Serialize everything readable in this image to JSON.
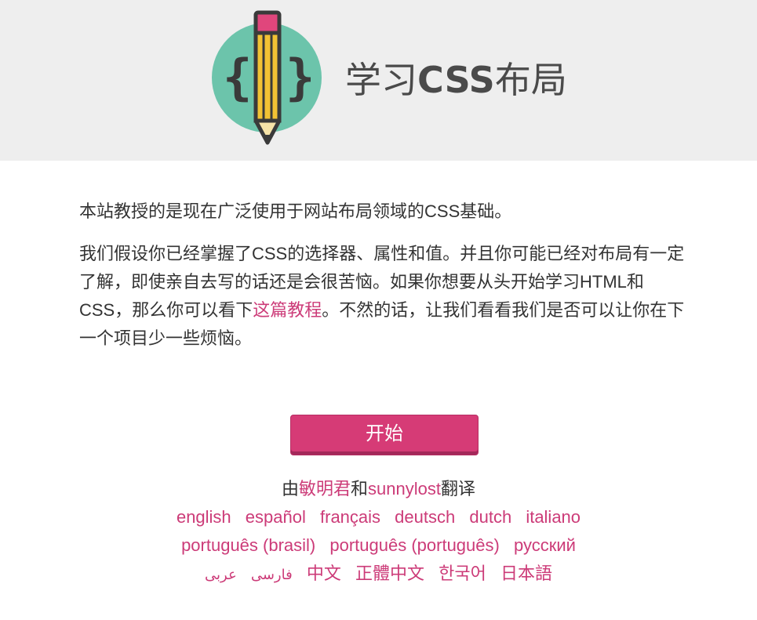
{
  "header": {
    "title_prefix": "学习",
    "title_css": "CSS",
    "title_suffix": "布局"
  },
  "intro": "本站教授的是现在广泛使用于网站布局领域的CSS基础。",
  "description": {
    "before_link": "我们假设你已经掌握了CSS的选择器、属性和值。并且你可能已经对布局有一定了解，即使亲自去写的话还是会很苦恼。如果你想要从头开始学习HTML和CSS，那么你可以看下",
    "link_text": "这篇教程",
    "after_link": "。不然的话，让我们看看我们是否可以让你在下一个项目少一些烦恼。"
  },
  "start_button": "开始",
  "credits": {
    "prefix": "由",
    "translator1": "敏明君",
    "joiner": "和",
    "translator2": "sunnylost",
    "suffix": "翻译"
  },
  "languages": {
    "row1": [
      "english",
      "español",
      "français",
      "deutsch",
      "dutch",
      "italiano"
    ],
    "row2": [
      "português (brasil)",
      "português (português)",
      "русский"
    ],
    "row3": [
      "عربى",
      "فارسی",
      "中文",
      "正體中文",
      "한국어",
      "日本語"
    ]
  },
  "colors": {
    "accent": "#cc3b78",
    "button": "#d63b76",
    "header_bg": "#eeeeee",
    "logo_circle": "#6cc4ab",
    "pencil_body": "#f2c234",
    "pencil_eraser": "#e0467c"
  },
  "icons": {
    "logo": "pencil-with-braces-logo"
  }
}
